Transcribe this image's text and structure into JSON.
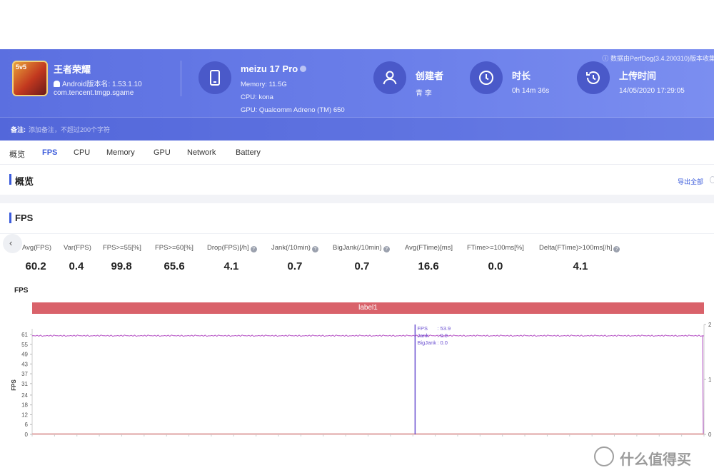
{
  "header": {
    "source_note": "数据由PerfDog(3.4.200310)版本收集",
    "app": {
      "name": "王者荣耀",
      "version": "Android版本名: 1.53.1.10",
      "package": "com.tencent.tmgp.sgame",
      "icon": "game-app-icon",
      "icon_badge": "5v5"
    },
    "device": {
      "name": "meizu 17 Pro",
      "memory": "Memory: 11.5G",
      "cpu": "CPU: kona",
      "gpu": "GPU: Qualcomm Adreno (TM) 650"
    },
    "creator": {
      "label": "创建者",
      "value": "青 李"
    },
    "duration": {
      "label": "时长",
      "value": "0h 14m 36s"
    },
    "upload": {
      "label": "上传时间",
      "value": "14/05/2020 17:29:05"
    },
    "note_label": "备注:",
    "note_placeholder": "添加备注，不超过200个字符"
  },
  "tabs": [
    {
      "label": "概览",
      "active": false
    },
    {
      "label": "FPS",
      "active": true
    },
    {
      "label": "CPU",
      "active": false
    },
    {
      "label": "Memory",
      "active": false
    },
    {
      "label": "GPU",
      "active": false
    },
    {
      "label": "Network",
      "active": false
    },
    {
      "label": "Battery",
      "active": false
    }
  ],
  "overview": {
    "title": "概览",
    "export": "导出全部"
  },
  "fps_section": {
    "title": "FPS",
    "stats": [
      {
        "label": "Avg(FPS)",
        "value": "60.2",
        "help": false
      },
      {
        "label": "Var(FPS)",
        "value": "0.4",
        "help": false
      },
      {
        "label": "FPS>=55[%]",
        "value": "99.8",
        "help": false
      },
      {
        "label": "FPS>=60[%]",
        "value": "65.6",
        "help": false
      },
      {
        "label": "Drop(FPS)[/h]",
        "value": "4.1",
        "help": true
      },
      {
        "label": "Jank(/10min)",
        "value": "0.7",
        "help": true
      },
      {
        "label": "BigJank(/10min)",
        "value": "0.7",
        "help": true
      },
      {
        "label": "Avg(FTime)[ms]",
        "value": "16.6",
        "help": false
      },
      {
        "label": "FTime>=100ms[%]",
        "value": "0.0",
        "help": false
      },
      {
        "label": "Delta(FTime)>100ms[/h]",
        "value": "4.1",
        "help": true
      }
    ],
    "chart_title": "FPS",
    "label_strip": "label1"
  },
  "chart_data": {
    "type": "line",
    "ylabel": "FPS",
    "y_ticks": [
      0,
      6,
      12,
      18,
      24,
      31,
      37,
      43,
      49,
      55,
      61
    ],
    "ylim": [
      0,
      61
    ],
    "y2_ticks": [
      0,
      1,
      2
    ],
    "y2lim": [
      0,
      2
    ],
    "series": [
      {
        "name": "FPS",
        "color": "#b44fc4",
        "approx_value": 60.2
      },
      {
        "name": "Jank",
        "color": "#6a4fd0",
        "approx_value": 0
      },
      {
        "name": "BigJank",
        "color": "#e0a0a0",
        "approx_value": 0
      }
    ],
    "cursor_fraction": 0.57,
    "tooltip": [
      {
        "label": "FPS",
        "value": ": 53.9"
      },
      {
        "label": "Jank",
        "value": ": 0.0"
      },
      {
        "label": "BigJank",
        "value": ": 0.0"
      }
    ],
    "grid": false
  },
  "watermark": "什么值得买"
}
